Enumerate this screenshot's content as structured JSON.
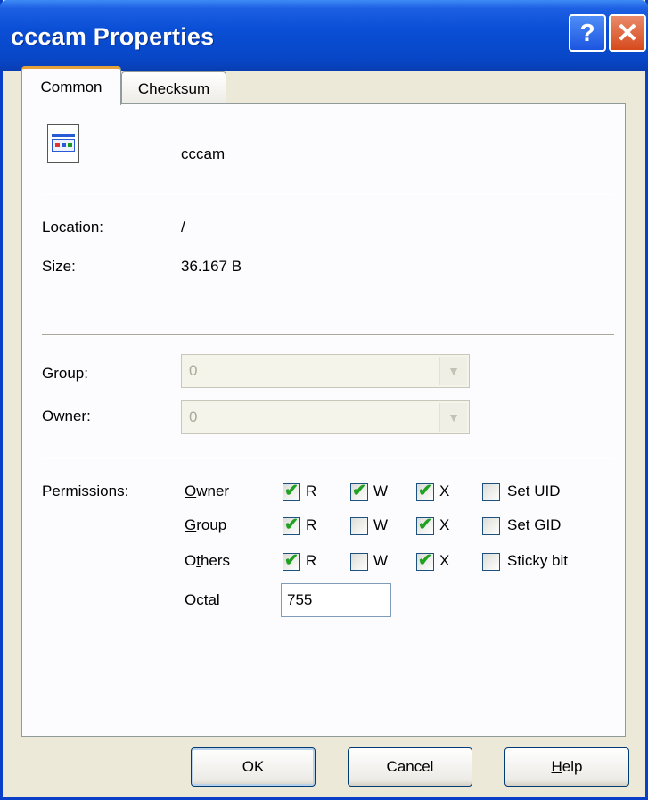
{
  "window": {
    "title": "cccam Properties",
    "help_icon": "?",
    "close_icon": "✕"
  },
  "tabs": [
    {
      "label": "Common",
      "active": true
    },
    {
      "label": "Checksum",
      "active": false
    }
  ],
  "file": {
    "icon": "executable-file-icon",
    "name": "cccam"
  },
  "info": {
    "location_label": "Location:",
    "location_value": "/",
    "size_label": "Size:",
    "size_value": "36.167 B"
  },
  "ownership": {
    "group_label": "Group:",
    "group_value": "0",
    "owner_label": "Owner:",
    "owner_value": "0",
    "dropdown_icon": "chevron-down-icon"
  },
  "permissions": {
    "label": "Permissions:",
    "rows": [
      {
        "accel": "O",
        "rest": "wner",
        "r": true,
        "w": true,
        "x": true,
        "special_label": "Set UID",
        "special": false
      },
      {
        "accel": "G",
        "rest": "roup",
        "r": true,
        "w": false,
        "x": true,
        "special_label": "Set GID",
        "special": false
      },
      {
        "pre": "O",
        "accel": "t",
        "rest": "hers",
        "r": true,
        "w": false,
        "x": true,
        "special_label": "Sticky bit",
        "special": false
      }
    ],
    "r_label": "R",
    "w_label": "W",
    "x_label": "X",
    "octal_pre": "O",
    "octal_accel": "c",
    "octal_rest": "tal",
    "octal_value": "755"
  },
  "buttons": {
    "ok": "OK",
    "cancel": "Cancel",
    "help_accel": "H",
    "help_rest": "elp"
  },
  "colors": {
    "titlebar": "#0a4fd6",
    "check": "#21a121",
    "dialog_bg": "#ece9d8"
  }
}
